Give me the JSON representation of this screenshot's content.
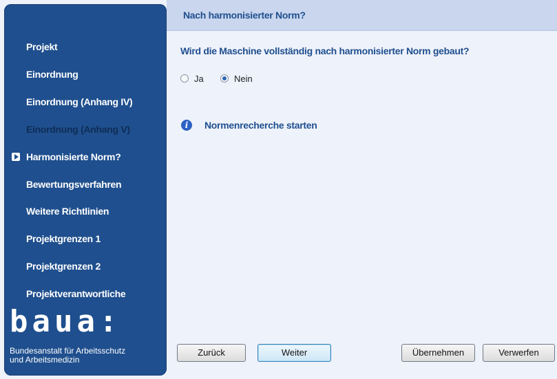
{
  "header": {
    "title": "Nach harmonisierter Norm?"
  },
  "sidebar": {
    "items": [
      {
        "label": "Projekt"
      },
      {
        "label": "Einordnung"
      },
      {
        "label": "Einordnung (Anhang IV)"
      },
      {
        "label": "Einordnung (Anhang V)"
      },
      {
        "label": "Harmonisierte Norm?"
      },
      {
        "label": "Bewertungsverfahren"
      },
      {
        "label": "Weitere Richtlinien"
      },
      {
        "label": "Projektgrenzen 1"
      },
      {
        "label": "Projektgrenzen 2"
      },
      {
        "label": "Projektverantwortliche"
      }
    ],
    "active_item": "Harmonisierte Norm?",
    "disabled_item": "Einordnung (Anhang V)",
    "logo": {
      "text": "baua:",
      "subtitle_line1": "Bundesanstalt für Arbeitsschutz",
      "subtitle_line2": "und Arbeitsmedizin"
    }
  },
  "main": {
    "question": "Wird die Maschine vollständig nach harmonisierter Norm gebaut?",
    "options": [
      {
        "label": "Ja",
        "checked": false
      },
      {
        "label": "Nein",
        "checked": true
      }
    ],
    "info_link": "Normenrecherche starten"
  },
  "buttons": {
    "back": "Zurück",
    "next": "Weiter",
    "apply": "Übernehmen",
    "discard": "Verwerfen"
  },
  "colors": {
    "sidebar": "#1f4f8e",
    "header": "#c9d6ee",
    "content_bg": "#eef2fb",
    "heading_text": "#1f4f8e"
  }
}
